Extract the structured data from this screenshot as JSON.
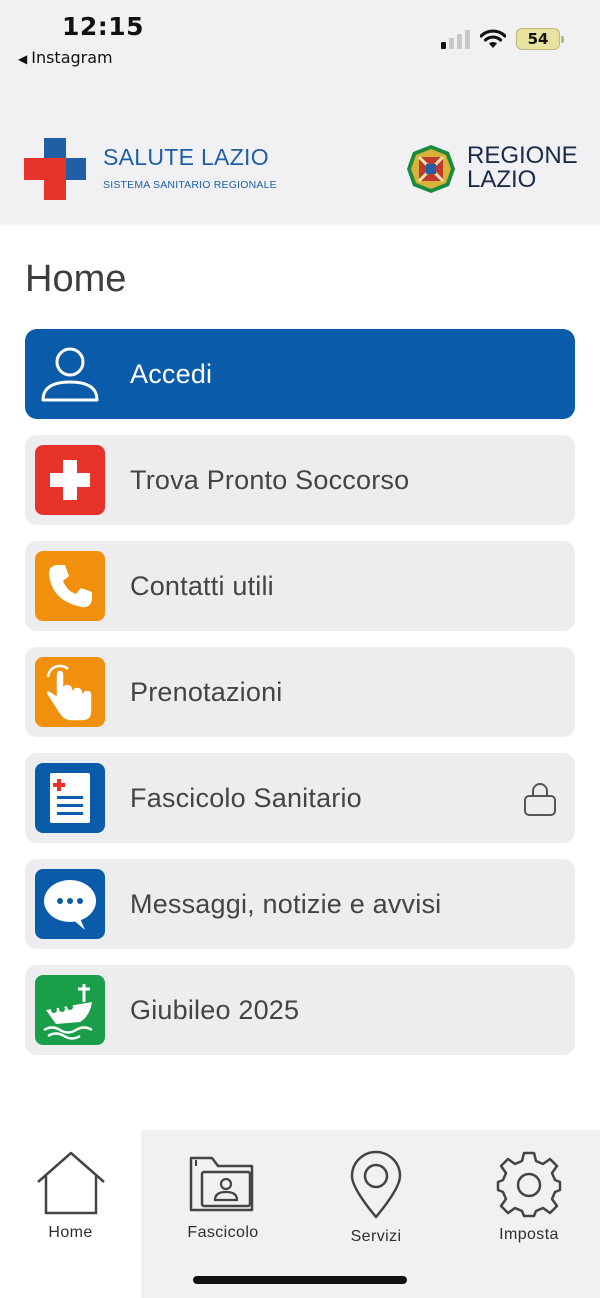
{
  "status_bar": {
    "time": "12:15",
    "back_app": "Instagram",
    "battery": "54"
  },
  "header": {
    "salute_title": "SALUTE LAZIO",
    "salute_subtitle": "SISTEMA SANITARIO REGIONALE",
    "regione_line1": "REGIONE",
    "regione_line2": "LAZIO"
  },
  "page": {
    "title": "Home"
  },
  "menu": {
    "items": [
      {
        "label": "Accedi",
        "icon": "user-icon",
        "color": "#0a5cab"
      },
      {
        "label": "Trova Pronto Soccorso",
        "icon": "first-aid-cross-icon",
        "color": "#e8332a"
      },
      {
        "label": "Contatti utili",
        "icon": "phone-icon",
        "color": "#f0900c"
      },
      {
        "label": "Prenotazioni",
        "icon": "hand-pointer-icon",
        "color": "#f0900c"
      },
      {
        "label": "Fascicolo Sanitario",
        "icon": "medical-record-icon",
        "color": "#0a5cab",
        "locked": true
      },
      {
        "label": "Messaggi, notizie e avvisi",
        "icon": "chat-bubble-icon",
        "color": "#0a5cab"
      },
      {
        "label": "Giubileo 2025",
        "icon": "jubilee-boat-icon",
        "color": "#1a9e4a"
      }
    ]
  },
  "tabbar": {
    "tabs": [
      {
        "label": "Home",
        "icon": "home-icon",
        "active": true
      },
      {
        "label": "Fascicolo",
        "icon": "folder-user-icon"
      },
      {
        "label": "Servizi",
        "icon": "map-pin-icon"
      },
      {
        "label": "Imposta",
        "icon": "gear-icon"
      }
    ]
  }
}
